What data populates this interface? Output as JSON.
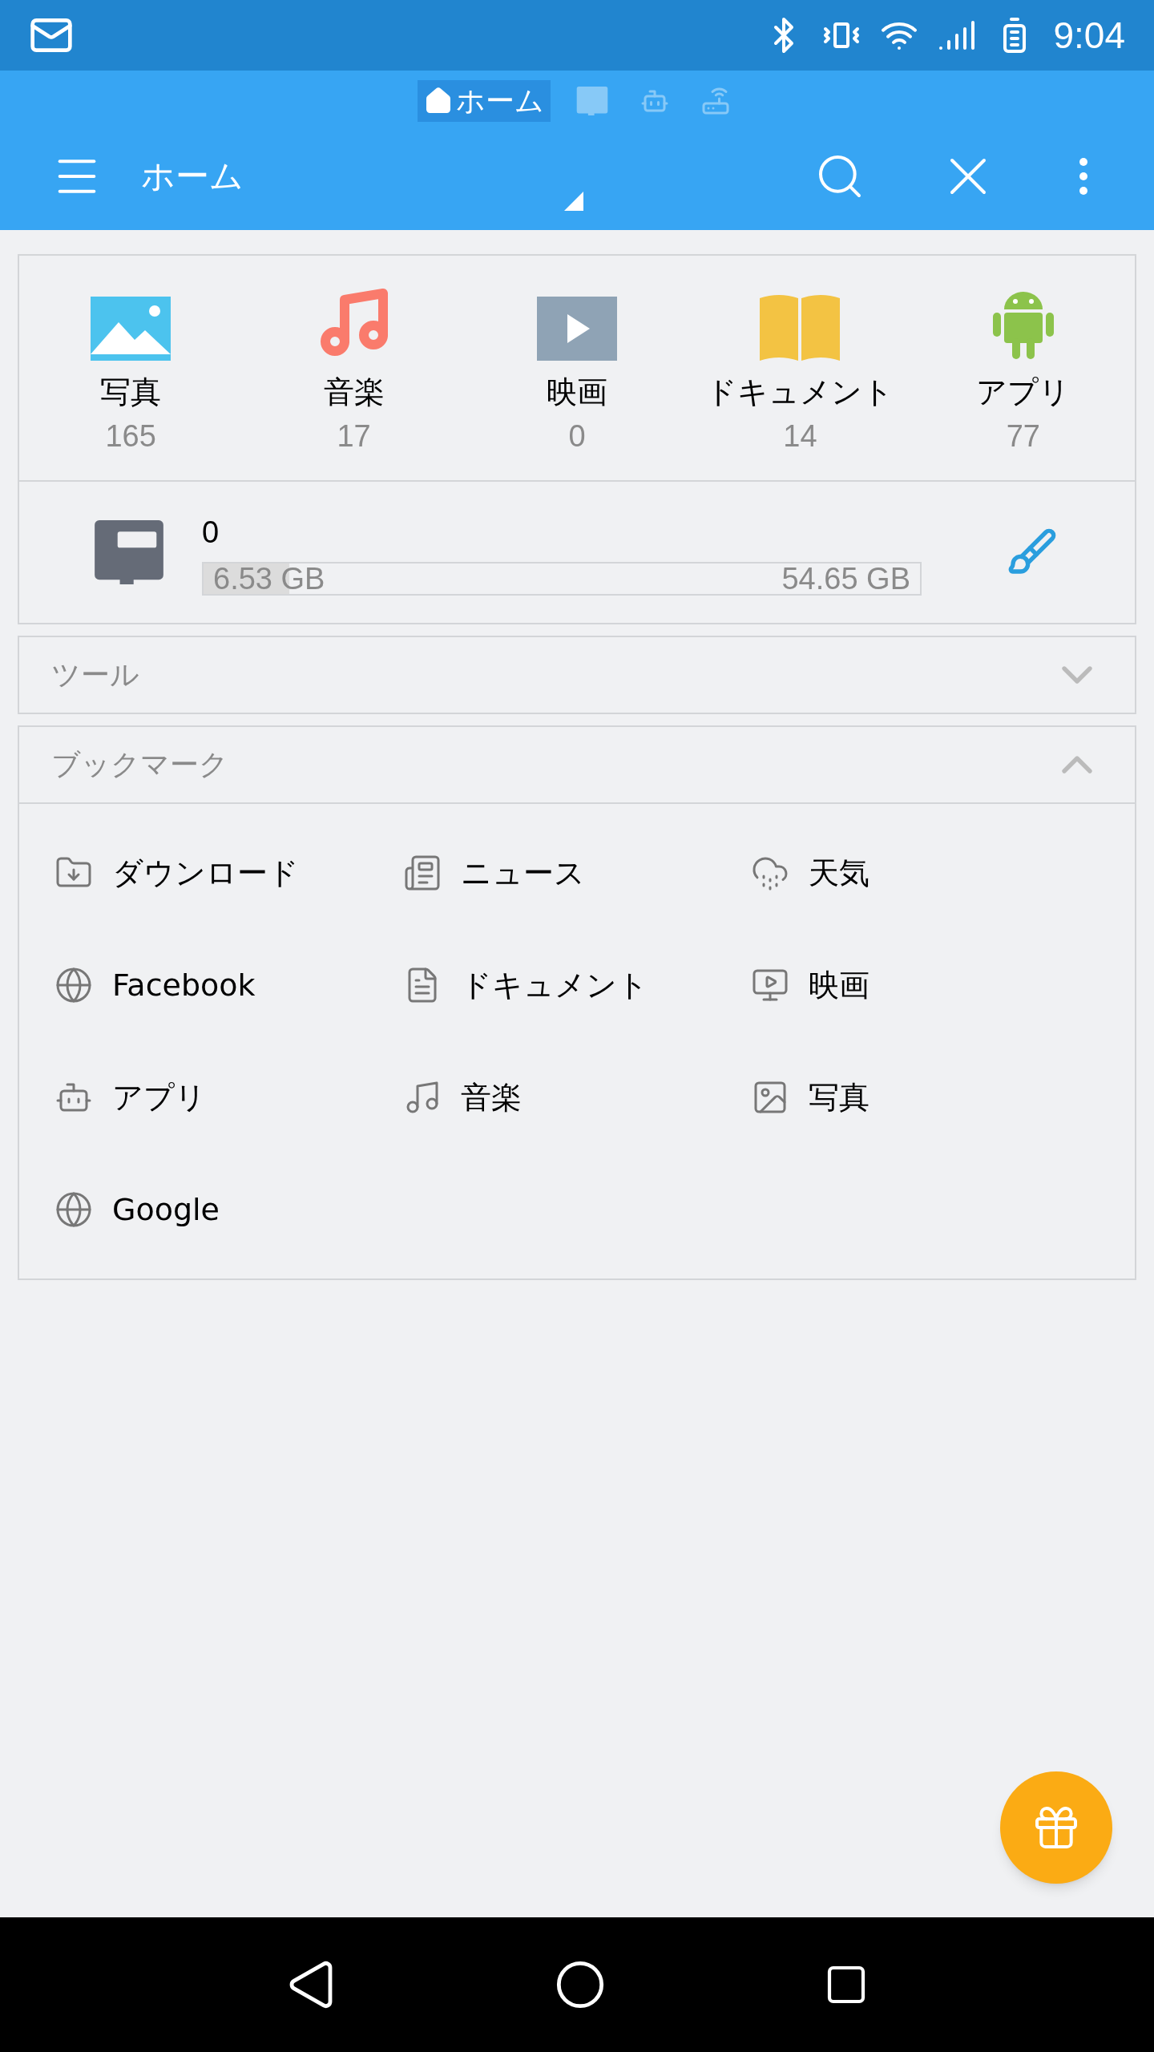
{
  "status_bar": {
    "time": "9:04"
  },
  "breadcrumb": [
    {
      "kind": "home",
      "label": "ホーム",
      "selected": true
    },
    {
      "kind": "sd",
      "selected": false
    },
    {
      "kind": "android",
      "selected": false
    },
    {
      "kind": "network",
      "selected": false
    }
  ],
  "app_bar": {
    "title": "ホーム"
  },
  "categories": [
    {
      "kind": "photo",
      "label": "写真",
      "count": "165"
    },
    {
      "kind": "music",
      "label": "音楽",
      "count": "17"
    },
    {
      "kind": "video",
      "label": "映画",
      "count": "0"
    },
    {
      "kind": "document",
      "label": "ドキュメント",
      "count": "14"
    },
    {
      "kind": "app",
      "label": "アプリ",
      "count": "77"
    }
  ],
  "storage": {
    "name": "0",
    "used": "6.53 GB",
    "total": "54.65 GB",
    "level": 0.12
  },
  "sections": [
    {
      "title": "ツール",
      "expanded": false
    },
    {
      "title": "ブックマーク",
      "expanded": true
    }
  ],
  "bookmarks": [
    {
      "kind": "download",
      "label": "ダウンロード"
    },
    {
      "kind": "news",
      "label": "ニュース"
    },
    {
      "kind": "weather",
      "label": "天気"
    },
    {
      "kind": "web",
      "label": "Facebook"
    },
    {
      "kind": "document",
      "label": "ドキュメント"
    },
    {
      "kind": "video",
      "label": "映画"
    },
    {
      "kind": "app",
      "label": "アプリ"
    },
    {
      "kind": "music",
      "label": "音楽"
    },
    {
      "kind": "photo",
      "label": "写真"
    },
    {
      "kind": "web",
      "label": "Google"
    }
  ]
}
